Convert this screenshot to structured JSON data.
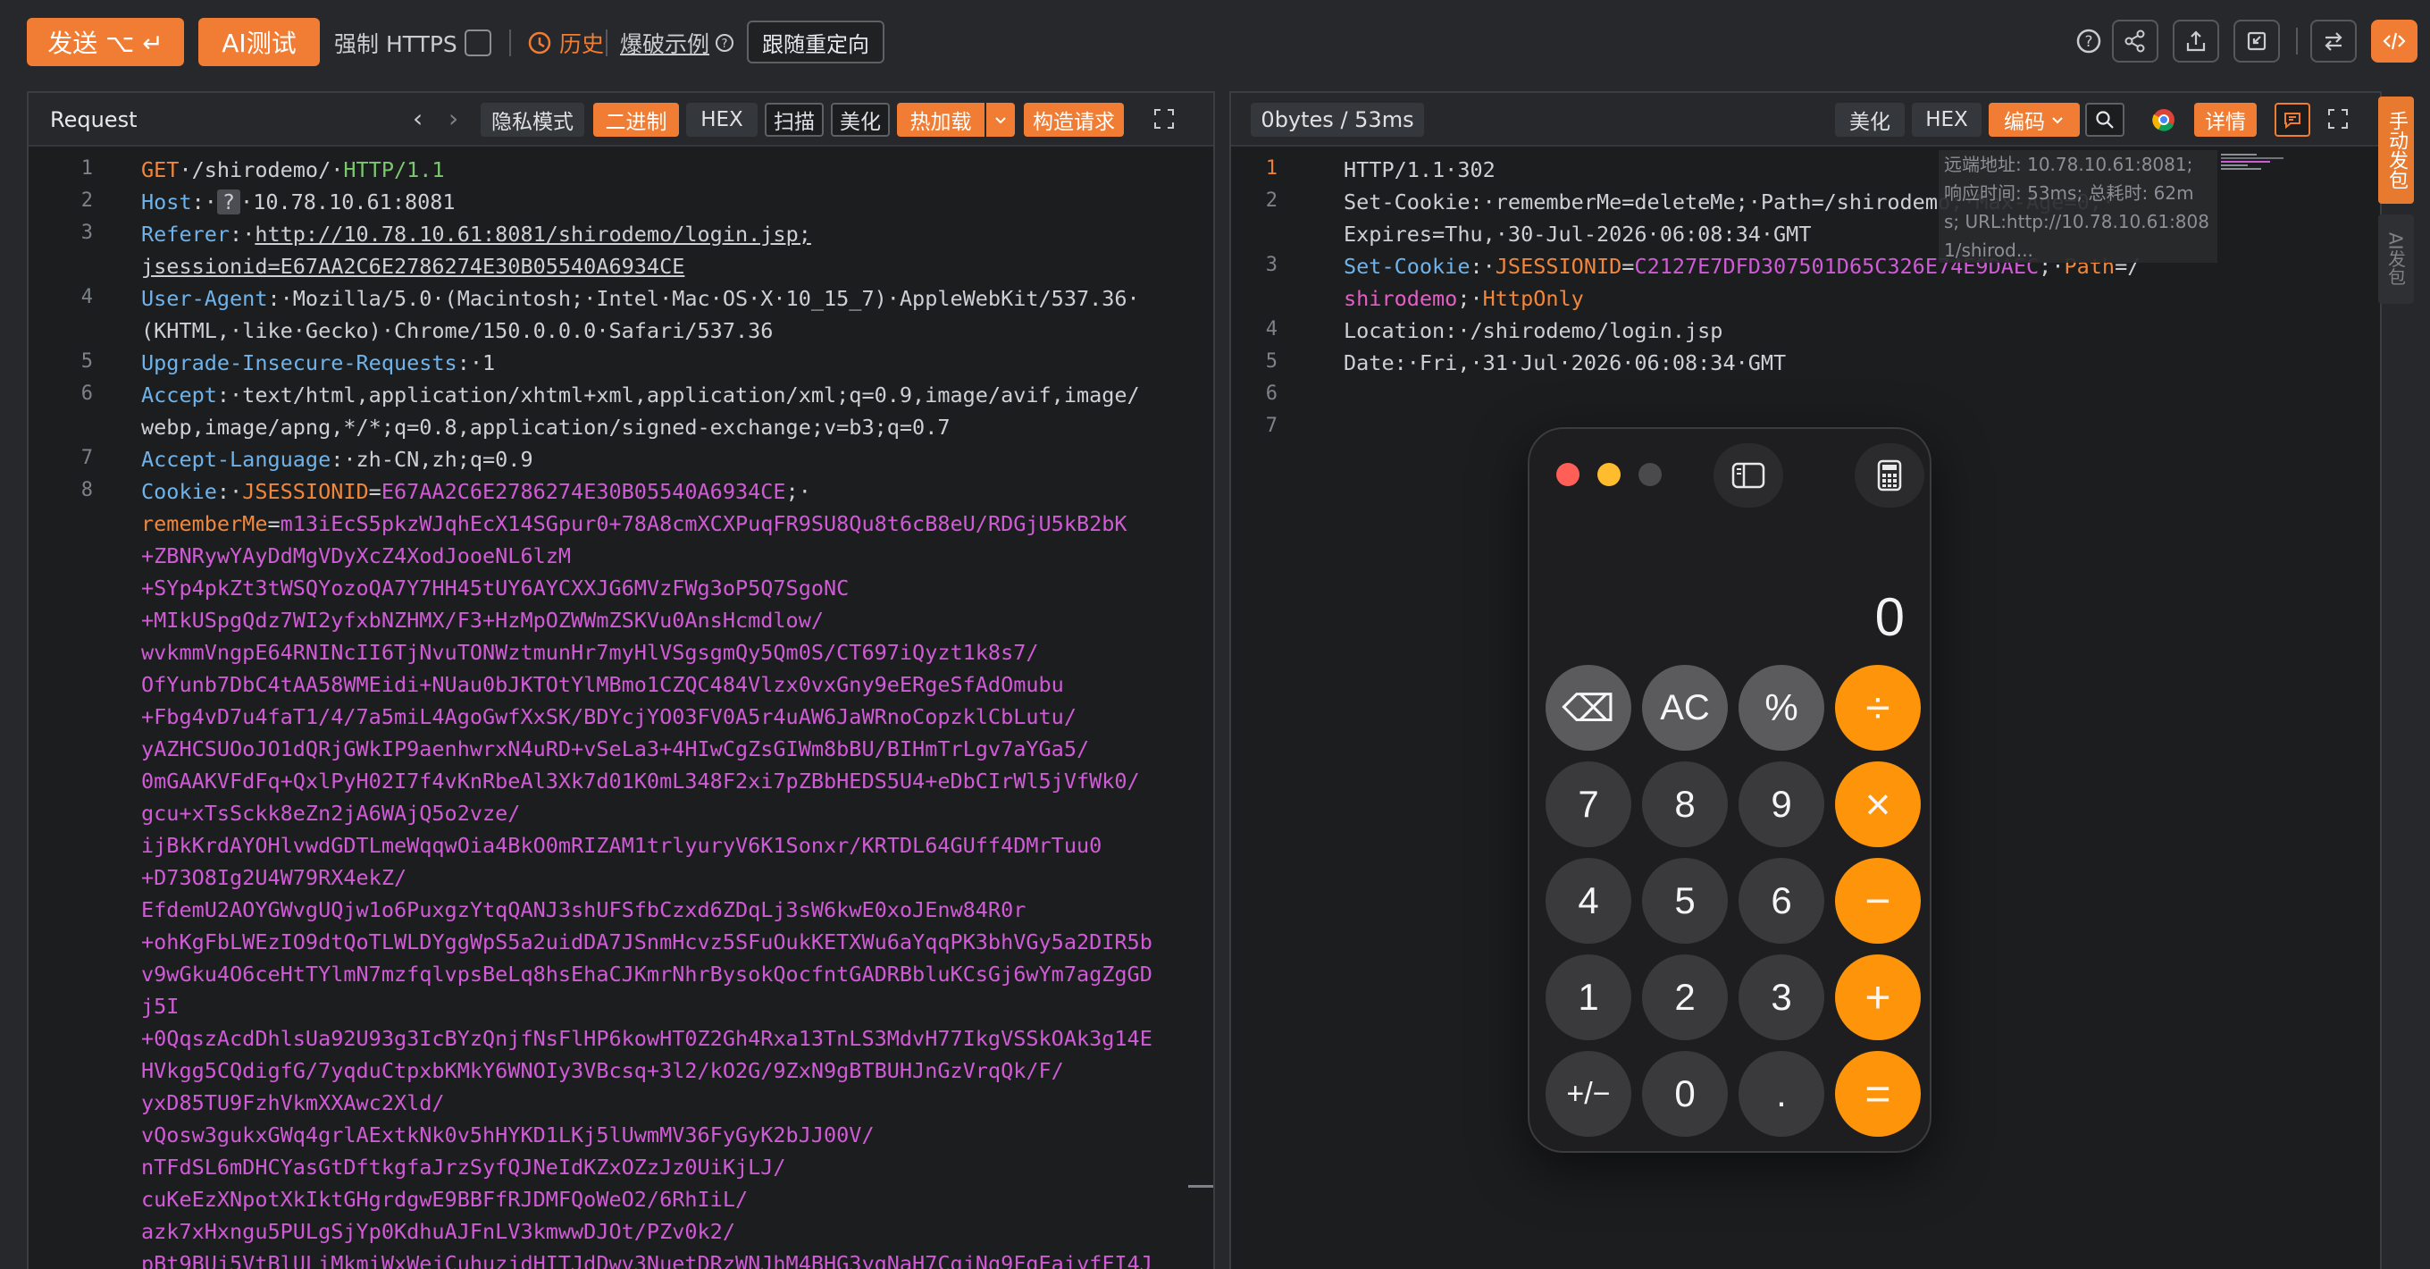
{
  "toolbar": {
    "send_label": "发送 ⌥ ↵",
    "ai_test_label": "AI测试",
    "force_https_label": "强制 HTTPS",
    "history_label": "历史",
    "brute_example_label": "爆破示例",
    "follow_redirect_label": "跟随重定向"
  },
  "request": {
    "title": "Request",
    "buttons": [
      "隐私模式",
      "二进制",
      "HEX",
      "扫描",
      "美化",
      "热加载",
      "构造请求"
    ],
    "lines": [
      {
        "n": "1",
        "parts": [
          [
            "kw-orange",
            "GET"
          ],
          [
            "",
            "·/shirodemo/·"
          ],
          [
            "kw-green",
            "HTTP/1.1"
          ]
        ]
      },
      {
        "n": "2",
        "parts": [
          [
            "kw-blue",
            "Host"
          ],
          [
            "",
            ":·"
          ],
          [
            "",
            "?"
          ],
          [
            "",
            "·10.78.10.61:8081"
          ]
        ]
      },
      {
        "n": "3",
        "parts": [
          [
            "kw-blue",
            "Referer"
          ],
          [
            "",
            ":·"
          ],
          [
            "underline",
            "http://10.78.10.61:8081/shirodemo/login.jsp;"
          ]
        ]
      },
      {
        "n": "",
        "parts": [
          [
            "underline",
            "jsessionid=E67AA2C6E2786274E30B05540A6934CE"
          ]
        ]
      },
      {
        "n": "4",
        "parts": [
          [
            "kw-blue",
            "User-Agent"
          ],
          [
            "",
            ":·Mozilla/5.0·(Macintosh;·Intel·Mac·OS·X·10_15_7)·AppleWebKit/537.36·"
          ]
        ]
      },
      {
        "n": "",
        "parts": [
          [
            "",
            "(KHTML,·like·Gecko)·Chrome/150.0.0.0·Safari/537.36"
          ]
        ]
      },
      {
        "n": "5",
        "parts": [
          [
            "kw-blue",
            "Upgrade-Insecure-Requests"
          ],
          [
            "",
            ":·1"
          ]
        ]
      },
      {
        "n": "6",
        "parts": [
          [
            "kw-blue",
            "Accept"
          ],
          [
            "",
            ":·text/html,application/xhtml+xml,application/xml;q=0.9,image/avif,image/"
          ]
        ]
      },
      {
        "n": "",
        "parts": [
          [
            "",
            "webp,image/apng,*/*;q=0.8,application/signed-exchange;v=b3;q=0.7"
          ]
        ]
      },
      {
        "n": "7",
        "parts": [
          [
            "kw-blue",
            "Accept-Language"
          ],
          [
            "",
            ":·zh-CN,zh;q=0.9"
          ]
        ]
      },
      {
        "n": "8",
        "parts": [
          [
            "kw-blue",
            "Cookie"
          ],
          [
            "",
            ":·"
          ],
          [
            "kw-orange",
            "JSESSIONID"
          ],
          [
            "",
            "="
          ],
          [
            "kw-magenta",
            "E67AA2C6E2786274E30B05540A6934CE"
          ],
          [
            "",
            ";·"
          ]
        ]
      },
      {
        "n": "",
        "parts": [
          [
            "kw-orange",
            "rememberMe"
          ],
          [
            "",
            "="
          ],
          [
            "kw-magenta",
            "m13iEcS5pkzWJqhEcX14SGpur0+78A8cmXCXPuqFR9SU8Qu8t6cB8eU/RDGjU5kB2bK"
          ]
        ]
      },
      {
        "n": "",
        "parts": [
          [
            "kw-magenta",
            "+ZBNRywYAyDdMgVDyXcZ4XodJooeNL6lzM"
          ]
        ]
      },
      {
        "n": "",
        "parts": [
          [
            "kw-magenta",
            "+SYp4pkZt3tWSQYozoQA7Y7HH45tUY6AYCXXJG6MVzFWg3oP5Q7SgoNC"
          ]
        ]
      },
      {
        "n": "",
        "parts": [
          [
            "kw-magenta",
            "+MIkUSpgQdz7WI2yfxbNZHMX/F3+HzMpOZWWmZSKVu0AnsHcmdlow/"
          ]
        ]
      },
      {
        "n": "",
        "parts": [
          [
            "kw-magenta",
            "wvkmmVngpE64RNINcII6TjNvuTONWztmunHr7myHlVSgsgmQy5Qm0S/CT697iQyzt1k8s7/"
          ]
        ]
      },
      {
        "n": "",
        "parts": [
          [
            "kw-magenta",
            "OfYunb7DbC4tAA58WMEidi+NUau0bJKTOtYlMBmo1CZQC484Vlzx0vxGny9eERgeSfAdOmubu"
          ]
        ]
      },
      {
        "n": "",
        "parts": [
          [
            "kw-magenta",
            "+Fbg4vD7u4faT1/4/7a5miL4AgoGwfXxSK/BDYcjYO03FV0A5r4uAW6JaWRnoCopzklCbLutu/"
          ]
        ]
      },
      {
        "n": "",
        "parts": [
          [
            "kw-magenta",
            "yAZHCSUOoJO1dQRjGWkIP9aenhwrxN4uRD+vSeLa3+4HIwCgZsGIWm8bBU/BIHmTrLgv7aYGa5/"
          ]
        ]
      },
      {
        "n": "",
        "parts": [
          [
            "kw-magenta",
            "0mGAAKVFdFq+QxlPyH02I7f4vKnRbeAl3Xk7d01K0mL348F2xi7pZBbHEDS5U4+eDbCIrWl5jVfWk0/"
          ]
        ]
      },
      {
        "n": "",
        "parts": [
          [
            "kw-magenta",
            "gcu+xTsSckk8eZn2jA6WAjQ5o2vze/"
          ]
        ]
      },
      {
        "n": "",
        "parts": [
          [
            "kw-magenta",
            "ijBkKrdAYOHlvwdGDTLmeWqqwOia4BkO0mRIZAM1trlyuryV6K1Sonxr/KRTDL64GUff4DMrTuu0"
          ]
        ]
      },
      {
        "n": "",
        "parts": [
          [
            "kw-magenta",
            "+D73O8Ig2U4W79RX4ekZ/"
          ]
        ]
      },
      {
        "n": "",
        "parts": [
          [
            "kw-magenta",
            "EfdemU2AOYGWvgUQjw1o6PuxgzYtqQANJ3shUFSfbCzxd6ZDqLj3sW6kwE0xoJEnw84R0r"
          ]
        ]
      },
      {
        "n": "",
        "parts": [
          [
            "kw-magenta",
            "+ohKgFbLWEzIO9dtQoTLWLDYggWpS5a2uidDA7JSnmHcvz5SFuOukKETXWu6aYqqPK3bhVGy5a2DIR5b"
          ]
        ]
      },
      {
        "n": "",
        "parts": [
          [
            "kw-magenta",
            "v9wGku4O6ceHtTYlmN7mzfqlvpsBeLq8hsEhaCJKmrNhrBysokQocfntGADRBbluKCsGj6wYm7agZgGD"
          ]
        ]
      },
      {
        "n": "",
        "parts": [
          [
            "kw-magenta",
            "j5I"
          ]
        ]
      },
      {
        "n": "",
        "parts": [
          [
            "kw-magenta",
            "+0QqszAcdDhlsUa92U93g3IcBYzQnjfNsFlHP6kowHT0Z2Gh4Rxa13TnLS3MdvH77IkgVSSkOAk3g14E"
          ]
        ]
      },
      {
        "n": "",
        "parts": [
          [
            "kw-magenta",
            "HVkgg5CQdigfG/7yqduCtpxbKMkY6WNOIy3VBcsq+3l2/kO2G/9ZxN9gBTBUHJnGzVrqQk/F/"
          ]
        ]
      },
      {
        "n": "",
        "parts": [
          [
            "kw-magenta",
            "yxD85TU9FzhVkmXXAwc2Xld/"
          ]
        ]
      },
      {
        "n": "",
        "parts": [
          [
            "kw-magenta",
            "vQosw3gukxGWq4grlAExtkNk0v5hHYKD1LKj5lUwmMV36FyGyK2bJJ00V/"
          ]
        ]
      },
      {
        "n": "",
        "parts": [
          [
            "kw-magenta",
            "nTFdSL6mDHCYasGtDftkgfaJrzSyfQJNeIdKZxOZzJz0UiKjLJ/"
          ]
        ]
      },
      {
        "n": "",
        "parts": [
          [
            "kw-magenta",
            "cuKeEzXNpotXkIktGHgrdgwE9BBFfRJDMFQoWeO2/6RhIiL/"
          ]
        ]
      },
      {
        "n": "",
        "parts": [
          [
            "kw-magenta",
            "azk7xHxngu5PULgSjYp0KdhuAJFnLV3kmwwDJOt/PZv0k2/"
          ]
        ]
      },
      {
        "n": "",
        "parts": [
          [
            "kw-magenta",
            "pBt9BUj5VtBlULiMkmiWxWejCuhuzjdHITJdDwv3NuetDRzWNJhM4BHG3ygNaH7CgjNq9FgEaiyfFI4J"
          ]
        ]
      }
    ]
  },
  "response": {
    "stats": "0bytes / 53ms",
    "buttons": [
      "美化",
      "HEX",
      "编码",
      "详情"
    ],
    "lines": [
      {
        "n": "1",
        "parts": [
          [
            "",
            "HTTP/1.1·302"
          ]
        ]
      },
      {
        "n": "2",
        "parts": [
          [
            "",
            "Set-Cookie:·rememberMe=deleteMe;·Path=/shirodemo;·Max-Age=0;·"
          ]
        ]
      },
      {
        "n": "",
        "parts": [
          [
            "",
            "Expires=Thu,·30-Jul-2026·06:08:34·GMT"
          ]
        ]
      },
      {
        "n": "3",
        "parts": [
          [
            "kw-blue",
            "Set-Cookie"
          ],
          [
            "",
            ":·"
          ],
          [
            "kw-orange",
            "JSESSIONID"
          ],
          [
            "",
            "="
          ],
          [
            "kw-magenta",
            "C2127E7DFD307501D65C326E74E9DAEC"
          ],
          [
            "",
            ";·"
          ],
          [
            "kw-orange",
            "Path"
          ],
          [
            "",
            "=/"
          ]
        ]
      },
      {
        "n": "",
        "parts": [
          [
            "kw-pink",
            "shirodemo"
          ],
          [
            "",
            ";·"
          ],
          [
            "kw-orange",
            "HttpOnly"
          ]
        ]
      },
      {
        "n": "4",
        "parts": [
          [
            "",
            "Location:·/shirodemo/login.jsp"
          ]
        ]
      },
      {
        "n": "5",
        "parts": [
          [
            "",
            "Date:·Fri,·31·Jul·2026·06:08:34·GMT"
          ]
        ]
      },
      {
        "n": "6",
        "parts": []
      },
      {
        "n": "7",
        "parts": []
      }
    ],
    "info_lines": [
      "远端地址: 10.78.10.61:8081;",
      "响应时间: 53ms; 总耗时: 62m",
      "s; URL:http://10.78.10.61:808",
      "1/shirod..."
    ]
  },
  "side_tabs": {
    "manual_send": "手动发包",
    "ai_send": "AI发包"
  },
  "calculator": {
    "display": "0",
    "keys": [
      [
        "⌫",
        "AC",
        "%",
        "÷"
      ],
      [
        "7",
        "8",
        "9",
        "×"
      ],
      [
        "4",
        "5",
        "6",
        "−"
      ],
      [
        "1",
        "2",
        "3",
        "+"
      ],
      [
        "+/−",
        "0",
        ".",
        "="
      ]
    ]
  },
  "colors": {
    "accent": "#f07d33",
    "calc_orange": "#fd9409"
  }
}
